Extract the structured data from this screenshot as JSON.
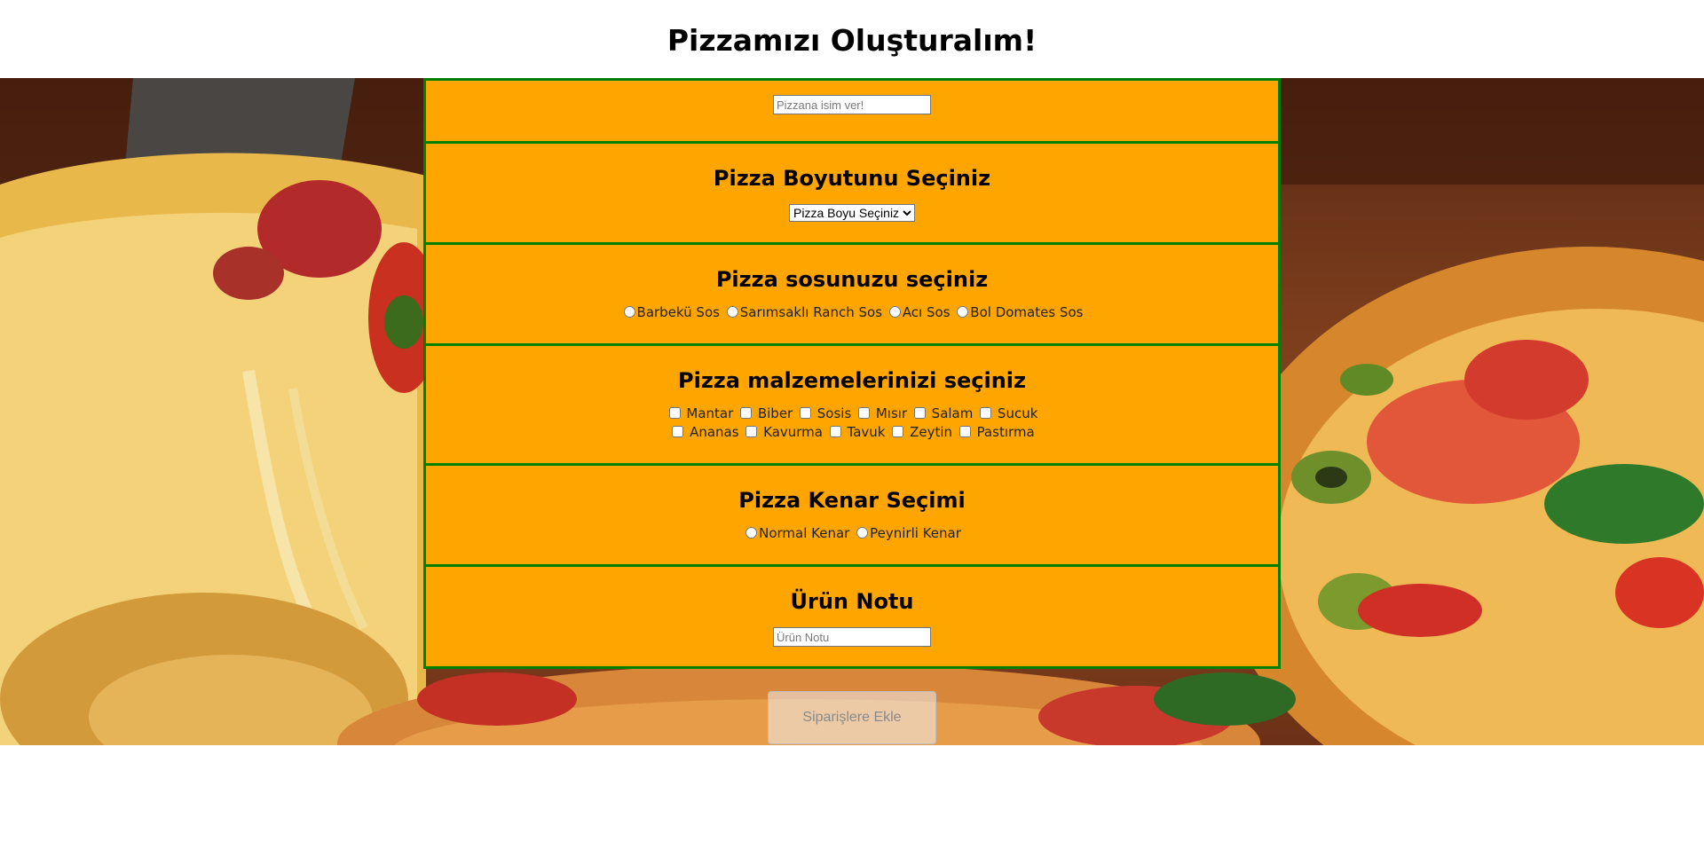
{
  "page": {
    "title": "Pizzamızı Oluşturalım!"
  },
  "name_section": {
    "placeholder": "Pizzana isim ver!"
  },
  "size_section": {
    "heading": "Pizza Boyutunu Seçiniz",
    "select_value": "Pizza Boyu Seçiniz"
  },
  "sauce_section": {
    "heading": "Pizza sosunuzu seçiniz",
    "options": [
      "Barbekü Sos",
      "Sarımsaklı Ranch Sos",
      "Acı Sos",
      "Bol Domates Sos"
    ]
  },
  "ingredients_section": {
    "heading": "Pizza malzemelerinizi seçiniz",
    "row1": [
      "Mantar",
      "Biber",
      "Sosis",
      "Mısır",
      "Salam",
      "Sucuk"
    ],
    "row2": [
      "Ananas",
      "Kavurma",
      "Tavuk",
      "Zeytin",
      "Pastırma"
    ]
  },
  "edge_section": {
    "heading": "Pizza Kenar Seçimi",
    "options": [
      "Normal Kenar",
      "Peynirli Kenar"
    ]
  },
  "note_section": {
    "heading": "Ürün Notu",
    "placeholder": "Ürün Notu"
  },
  "order_button": {
    "label": "Siparişlere Ekle"
  },
  "colors": {
    "section_bg": "#ffa500",
    "section_border": "#008000"
  },
  "icons": {
    "hero": "pizza-photo"
  }
}
